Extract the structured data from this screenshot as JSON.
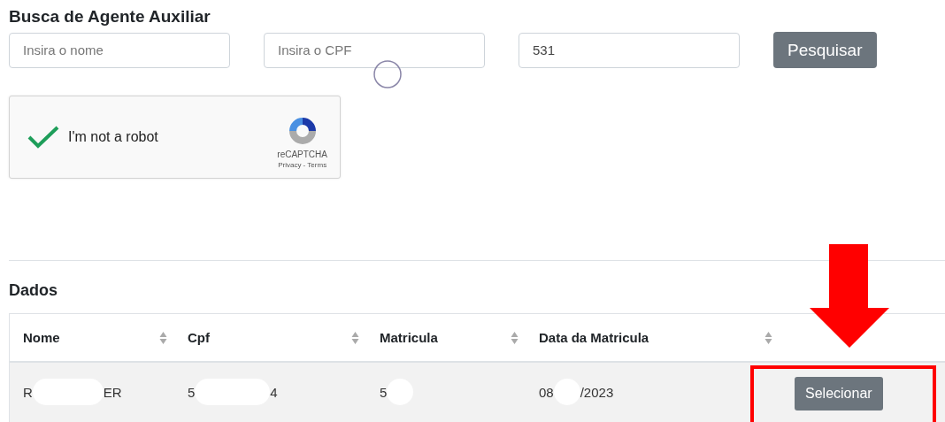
{
  "title": "Busca de Agente Auxiliar",
  "search": {
    "fields": [
      {
        "placeholder": "Insira o nome"
      },
      {
        "placeholder": "Insira o CPF"
      },
      {
        "value": "531"
      }
    ],
    "button": "Pesquisar"
  },
  "captcha": {
    "checked": true,
    "label": "I'm not a robot",
    "brand": "reCAPTCHA",
    "links": "Privacy - Terms"
  },
  "data_section": {
    "title": "Dados",
    "table": {
      "columns": [
        {
          "label": "Nome",
          "sortable": true
        },
        {
          "label": "Cpf",
          "sortable": true
        },
        {
          "label": "Matricula",
          "sortable": true
        },
        {
          "label": "Data da Matricula",
          "sortable": true
        }
      ],
      "rows": [
        {
          "cells": [
            {
              "segments": [
                "R",
                "ER"
              ],
              "redacted_middle": true
            },
            {
              "segments": [
                "5",
                "4"
              ],
              "redacted_middle": true
            },
            {
              "segments": [
                "5"
              ],
              "redacted_end": true
            },
            {
              "segments": [
                "08",
                "/2023"
              ],
              "redacted_middle": true
            }
          ],
          "action": "Selecionar"
        }
      ]
    }
  }
}
